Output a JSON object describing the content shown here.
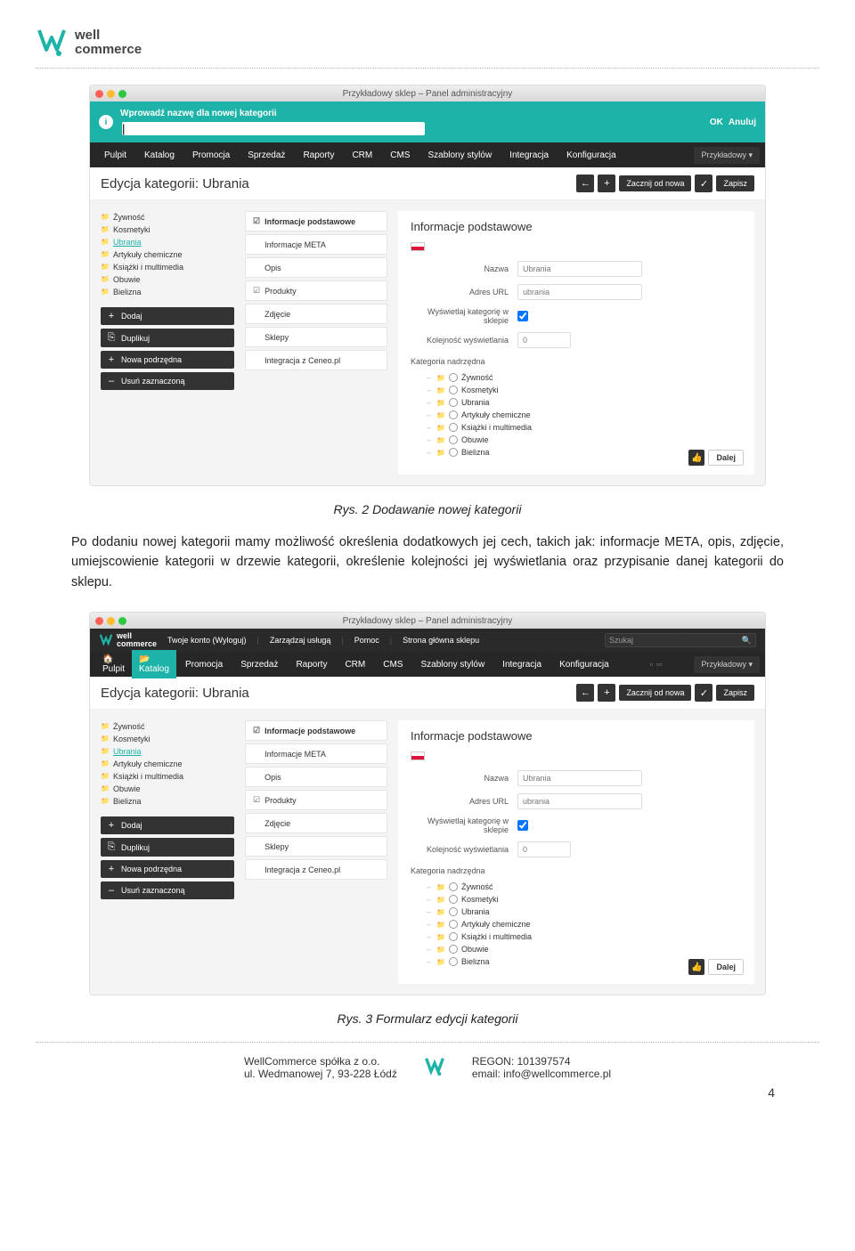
{
  "logo": {
    "line1": "well",
    "line2": "commerce"
  },
  "screenshot1": {
    "window_title": "Przykładowy sklep – Panel administracyjny",
    "prompt_bar": {
      "label": "Wprowadź nazwę dla nowej kategorii",
      "ok": "OK",
      "cancel": "Anuluj"
    },
    "nav": [
      "Pulpit",
      "Katalog",
      "Promocja",
      "Sprzedaż",
      "Raporty",
      "CRM",
      "CMS",
      "Szablony stylów",
      "Integracja",
      "Konfiguracja"
    ],
    "nav_active": "Katalog",
    "przyk": "Przykładowy ▾",
    "breadcrumb": "Edycja kategorii: Ubrania",
    "bc_new": "Zacznij od nowa",
    "bc_save": "Zapisz",
    "tree_items": [
      "Żywność",
      "Kosmetyki",
      "Ubrania",
      "Artykuły chemiczne",
      "Książki i multimedia",
      "Obuwie",
      "Bielizna"
    ],
    "tree_selected": "Ubrania",
    "sidebar_actions": [
      {
        "icon": "+",
        "label": "Dodaj"
      },
      {
        "icon": "⎘",
        "label": "Duplikuj"
      },
      {
        "icon": "+",
        "label": "Nowa podrzędna"
      },
      {
        "icon": "–",
        "label": "Usuń zaznaczoną"
      }
    ],
    "tabs": [
      "Informacje podstawowe",
      "Informacje META",
      "Opis",
      "Produkty",
      "Zdjęcie",
      "Sklepy",
      "Integracja z Ceneo.pl"
    ],
    "tab_checked": [
      "Informacje podstawowe",
      "Produkty"
    ],
    "form_title": "Informacje podstawowe",
    "field_nazwa": "Nazwa",
    "val_nazwa": "Ubrania",
    "field_url": "Adres URL",
    "val_url": "ubrania",
    "field_show": "Wyświetlaj kategorię w sklepie",
    "field_order": "Kolejność wyświetlania",
    "val_order": "0",
    "field_parent": "Kategoria nadrzędna",
    "radio_tree": [
      "Żywność",
      "Kosmetyki",
      "Ubrania",
      "Artykuły chemiczne",
      "Książki i multimedia",
      "Obuwie",
      "Bielizna"
    ],
    "dalej": "Dalej"
  },
  "caption1": "Rys. 2 Dodawanie nowej kategorii",
  "paragraph": "Po dodaniu nowej kategorii mamy możliwość określenia dodatkowych jej cech, takich jak: informacje META, opis, zdjęcie, umiejscowienie kategorii w drzewie kategorii, określenie kolejności jej wyświetlania oraz przypisanie danej kategorii do sklepu.",
  "screenshot2": {
    "top_links": [
      "Twoje konto (Wyloguj)",
      "Zarządzaj usługą",
      "Pomoc",
      "Strona główna sklepu"
    ],
    "search_ph": "Szukaj"
  },
  "caption2": "Rys. 3 Formularz edycji kategorii",
  "footer": {
    "company": "WellCommerce spółka z o.o.",
    "address": "ul. Wedmanowej 7, 93-228 Łódź",
    "regon": "REGON: 101397574",
    "email": "email: info@wellcommerce.pl"
  },
  "page_number": "4"
}
